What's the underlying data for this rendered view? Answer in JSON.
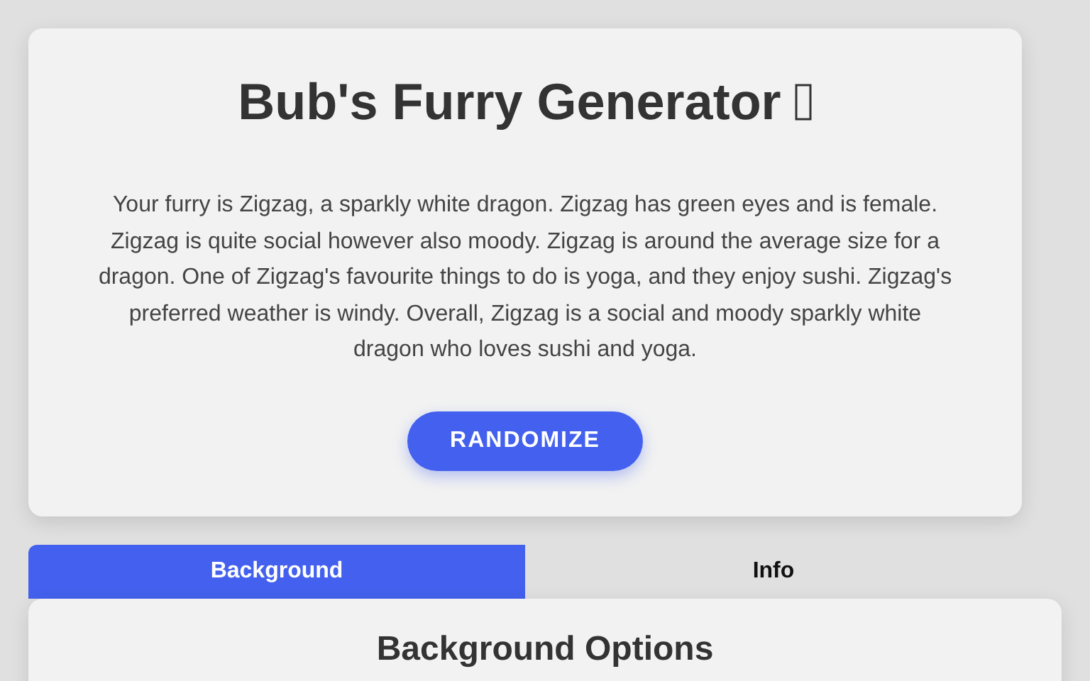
{
  "title": "Bub's Furry Generator",
  "description": "Your furry is Zigzag, a sparkly white dragon. Zigzag has green eyes and is female. Zigzag is quite social however also moody. Zigzag is around the average size for a dragon. One of Zigzag's favourite things to do is yoga, and they enjoy sushi. Zigzag's preferred weather is windy. Overall, Zigzag is a social and moody sparkly white dragon who loves sushi and yoga.",
  "button": "RANDOMIZE",
  "tabs": [
    {
      "label": "Background",
      "selected": true
    },
    {
      "label": "Info",
      "selected": false
    }
  ],
  "panel": {
    "heading": "Background Options"
  }
}
